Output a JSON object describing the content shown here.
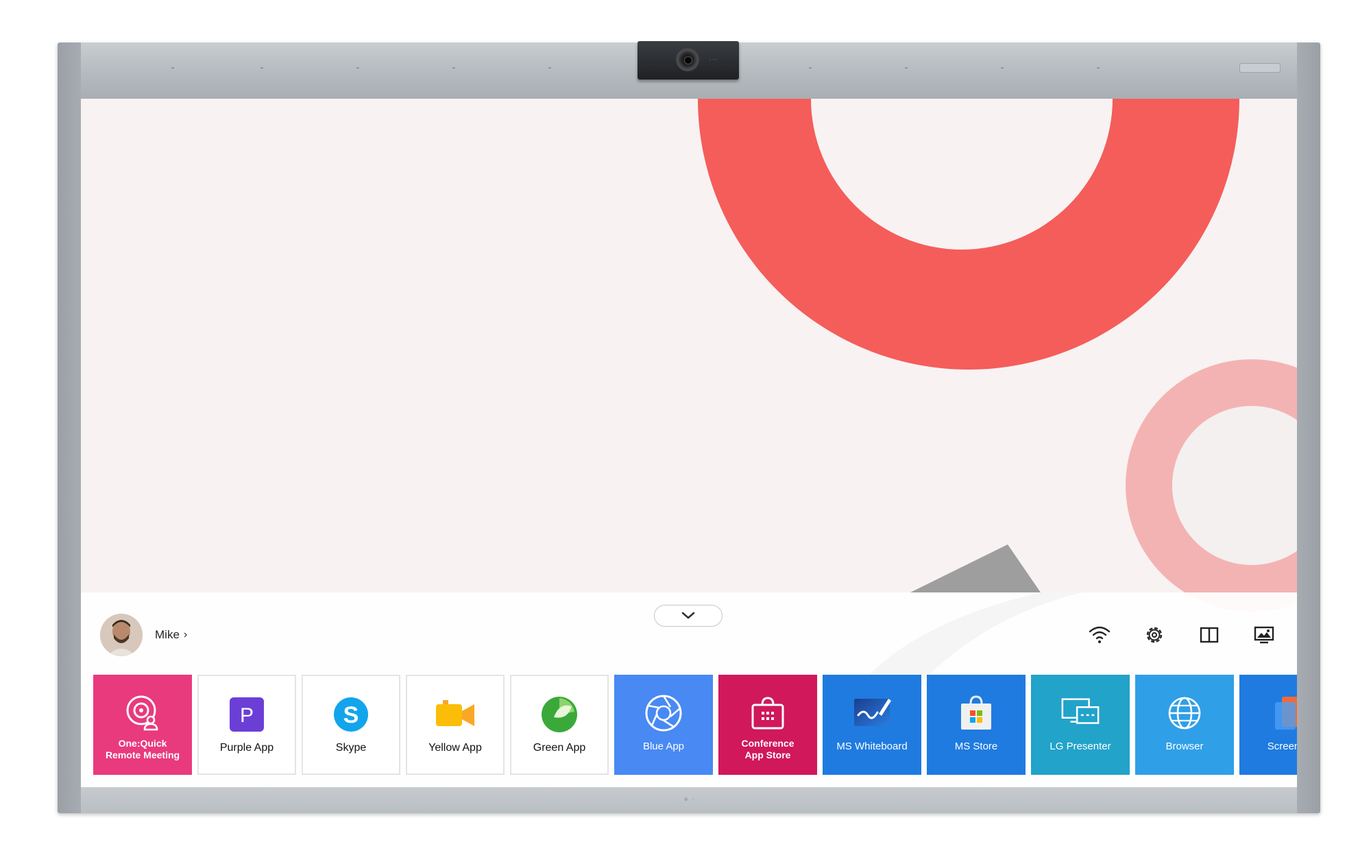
{
  "colors": {
    "wallpaper_bg": "#f8f2f2",
    "wallpaper_ring_1": "#f45d5a",
    "wallpaper_ring_2": "#f4b3b3",
    "wallpaper_wedge": "#9e9e9e"
  },
  "user": {
    "name": "Mike",
    "chevron": "›",
    "avatar_icon": "user-avatar-photo"
  },
  "collapse_icon": "chevron-down-icon",
  "system_icons": [
    "wifi-icon",
    "settings-gear-icon",
    "split-screen-icon",
    "screen-image-icon"
  ],
  "apps": [
    {
      "label_1": "One:Quick",
      "label_2": "Remote Meeting",
      "bg": "#e93a7d",
      "style": "dark",
      "icon": "remote-meeting-icon"
    },
    {
      "label_1": "Purple App",
      "bg": "#ffffff",
      "style": "light",
      "icon": "purple-app-icon",
      "letter": "P"
    },
    {
      "label_1": "Skype",
      "bg": "#ffffff",
      "style": "light",
      "icon": "skype-icon",
      "letter": "S"
    },
    {
      "label_1": "Yellow App",
      "bg": "#ffffff",
      "style": "light",
      "icon": "video-camera-icon"
    },
    {
      "label_1": "Green App",
      "bg": "#ffffff",
      "style": "light",
      "icon": "green-app-icon"
    },
    {
      "label_1": "Blue App",
      "bg": "#4889f4",
      "style": "dark",
      "icon": "aperture-icon"
    },
    {
      "label_1": "Conference",
      "label_2": "App Store",
      "bg": "#d0185b",
      "style": "dark",
      "icon": "app-store-bag-icon"
    },
    {
      "label_1": "MS Whiteboard",
      "bg": "#1f7be0",
      "style": "dark",
      "icon": "whiteboard-icon"
    },
    {
      "label_1": "MS Store",
      "bg": "#1f7be0",
      "style": "dark",
      "icon": "ms-store-icon"
    },
    {
      "label_1": "LG Presenter",
      "bg": "#22a3c9",
      "style": "dark",
      "icon": "presenter-icon"
    },
    {
      "label_1": "Browser",
      "bg": "#2f9fe8",
      "style": "dark",
      "icon": "globe-icon"
    },
    {
      "label_1": "Screen C",
      "bg": "#1f7be0",
      "style": "dark",
      "icon": "screen-share-icon"
    }
  ]
}
